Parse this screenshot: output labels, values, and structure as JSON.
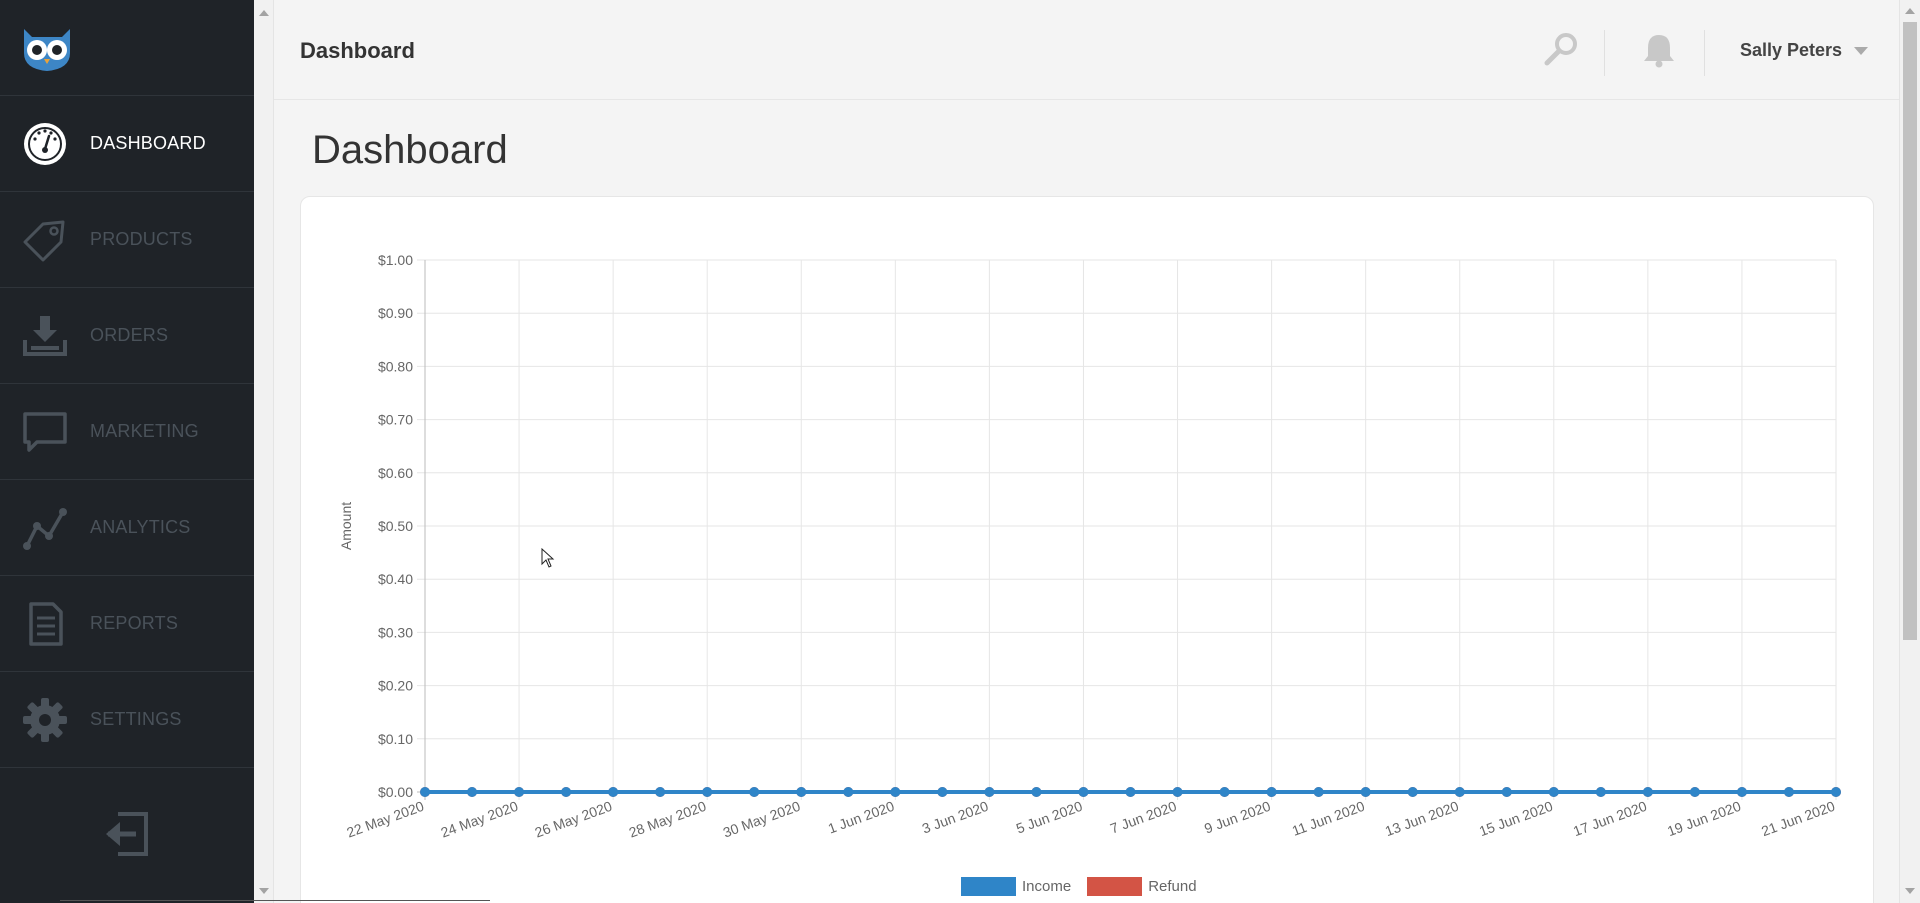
{
  "sidebar": {
    "items": [
      {
        "label": "DASHBOARD",
        "icon": "gauge-icon"
      },
      {
        "label": "PRODUCTS",
        "icon": "tag-icon"
      },
      {
        "label": "ORDERS",
        "icon": "download-tray-icon"
      },
      {
        "label": "MARKETING",
        "icon": "speech-bubble-icon"
      },
      {
        "label": "ANALYTICS",
        "icon": "line-graph-icon"
      },
      {
        "label": "REPORTS",
        "icon": "document-icon"
      },
      {
        "label": "SETTINGS",
        "icon": "gear-icon"
      }
    ],
    "active": "DASHBOARD",
    "logout_icon": "logout-icon",
    "logo_icon": "owl-logo-icon"
  },
  "header": {
    "title": "Dashboard",
    "search_icon": "search-icon",
    "notifications_icon": "bell-icon",
    "user_name": "Sally Peters"
  },
  "page": {
    "title": "Dashboard"
  },
  "colors": {
    "sidebar_bg": "#1f2328",
    "income": "#2f85c8",
    "refund": "#d35445",
    "active_label": "#ffffff",
    "inactive_label": "#4a525a"
  },
  "chart_data": {
    "type": "line",
    "ylabel": "Amount",
    "xlabel": "",
    "ylim": [
      0,
      1
    ],
    "y_ticks": [
      "$0.00",
      "$0.10",
      "$0.20",
      "$0.30",
      "$0.40",
      "$0.50",
      "$0.60",
      "$0.70",
      "$0.80",
      "$0.90",
      "$1.00"
    ],
    "x_tick_labels": [
      "22 May 2020",
      "24 May 2020",
      "26 May 2020",
      "28 May 2020",
      "30 May 2020",
      "1 Jun 2020",
      "3 Jun 2020",
      "5 Jun 2020",
      "7 Jun 2020",
      "9 Jun 2020",
      "11 Jun 2020",
      "13 Jun 2020",
      "15 Jun 2020",
      "17 Jun 2020",
      "19 Jun 2020",
      "21 Jun 2020"
    ],
    "x": [
      "22 May 2020",
      "23 May 2020",
      "24 May 2020",
      "25 May 2020",
      "26 May 2020",
      "27 May 2020",
      "28 May 2020",
      "29 May 2020",
      "30 May 2020",
      "31 May 2020",
      "1 Jun 2020",
      "2 Jun 2020",
      "3 Jun 2020",
      "4 Jun 2020",
      "5 Jun 2020",
      "6 Jun 2020",
      "7 Jun 2020",
      "8 Jun 2020",
      "9 Jun 2020",
      "10 Jun 2020",
      "11 Jun 2020",
      "12 Jun 2020",
      "13 Jun 2020",
      "14 Jun 2020",
      "15 Jun 2020",
      "16 Jun 2020",
      "17 Jun 2020",
      "18 Jun 2020",
      "19 Jun 2020",
      "20 Jun 2020",
      "21 Jun 2020"
    ],
    "series": [
      {
        "name": "Income",
        "color": "#2f85c8",
        "values": [
          0,
          0,
          0,
          0,
          0,
          0,
          0,
          0,
          0,
          0,
          0,
          0,
          0,
          0,
          0,
          0,
          0,
          0,
          0,
          0,
          0,
          0,
          0,
          0,
          0,
          0,
          0,
          0,
          0,
          0,
          0
        ]
      },
      {
        "name": "Refund",
        "color": "#d35445",
        "values": [
          0,
          0,
          0,
          0,
          0,
          0,
          0,
          0,
          0,
          0,
          0,
          0,
          0,
          0,
          0,
          0,
          0,
          0,
          0,
          0,
          0,
          0,
          0,
          0,
          0,
          0,
          0,
          0,
          0,
          0,
          0
        ]
      }
    ],
    "grid": true,
    "legend": "bottom-center"
  }
}
